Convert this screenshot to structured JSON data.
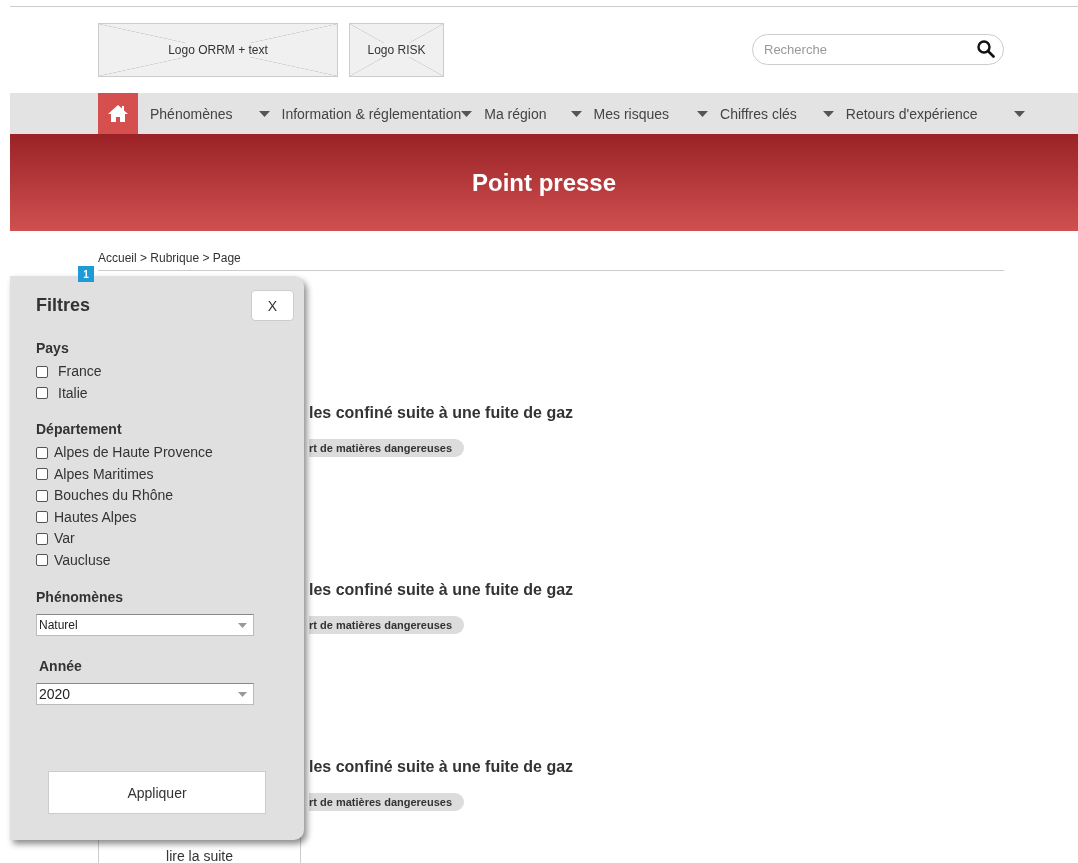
{
  "logos": [
    {
      "label": "Logo ORRM + text"
    },
    {
      "label": "Logo RISK"
    }
  ],
  "search": {
    "placeholder": "Recherche"
  },
  "nav": [
    {
      "label": "Phénomènes"
    },
    {
      "label": "Information & réglementation"
    },
    {
      "label": "Ma région"
    },
    {
      "label": "Mes risques"
    },
    {
      "label": "Chiffres clés"
    },
    {
      "label": "Retours d'expérience"
    }
  ],
  "banner": {
    "title": "Point presse"
  },
  "breadcrumb": "Accueil > Rubrique > Page",
  "annotation_badge": "1",
  "articles": [
    {
      "title": "les confiné suite à une fuite de gaz",
      "tag": "rt de matières dangereuses"
    },
    {
      "title": "les confiné suite à une fuite de gaz",
      "tag": "rt de matières dangereuses"
    },
    {
      "title": "les confiné suite à une fuite de gaz",
      "tag": "rt de matières dangereuses"
    }
  ],
  "read_more": "lire la suite",
  "filters": {
    "title": "Filtres",
    "close": "X",
    "groups": [
      {
        "label": "Pays",
        "options": [
          {
            "label": "France",
            "checked": false
          },
          {
            "label": "Italie",
            "checked": false
          }
        ]
      },
      {
        "label": "Département",
        "options": [
          {
            "label": "Alpes de Haute Provence",
            "checked": false
          },
          {
            "label": "Alpes Maritimes",
            "checked": false
          },
          {
            "label": "Bouches du Rhône",
            "checked": false
          },
          {
            "label": "Hautes Alpes",
            "checked": false
          },
          {
            "label": "Var",
            "checked": false
          },
          {
            "label": "Vaucluse",
            "checked": false
          }
        ]
      }
    ],
    "selects": [
      {
        "label": "Phénomènes",
        "value": "Naturel"
      },
      {
        "label": "Année",
        "value": "2020"
      }
    ],
    "apply": "Appliquer"
  }
}
